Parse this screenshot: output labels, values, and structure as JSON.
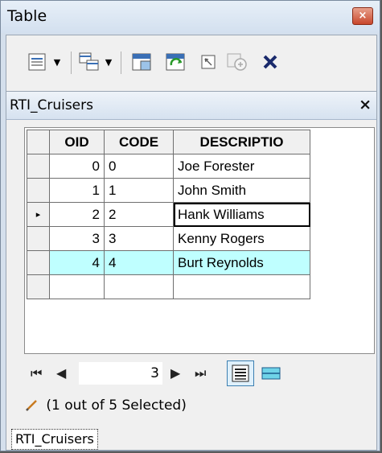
{
  "window": {
    "title": "Table",
    "close_glyph": "×"
  },
  "toolbar": {
    "buttons": [
      {
        "icon": "table-options-icon",
        "has_dropdown": true
      },
      {
        "icon": "related-tables-icon",
        "has_dropdown": true
      },
      {
        "icon": "select-by-attributes-icon"
      },
      {
        "icon": "switch-selection-icon"
      },
      {
        "icon": "clear-selection-icon"
      },
      {
        "icon": "zoom-to-selected-icon"
      },
      {
        "icon": "delete-selected-icon"
      }
    ]
  },
  "panel": {
    "title": "RTI_Cruisers",
    "close_glyph": "×"
  },
  "table": {
    "columns": [
      "OID",
      "CODE",
      "DESCRIPTIO"
    ],
    "rows": [
      {
        "oid": "0",
        "code": "0",
        "desc": "Joe Forester"
      },
      {
        "oid": "1",
        "code": "1",
        "desc": "John Smith"
      },
      {
        "oid": "2",
        "code": "2",
        "desc": "Hank Williams"
      },
      {
        "oid": "3",
        "code": "3",
        "desc": "Kenny Rogers"
      },
      {
        "oid": "4",
        "code": "4",
        "desc": "Burt Reynolds"
      }
    ],
    "current_row_marker": "▸",
    "highlight_color": "#bfffff"
  },
  "nav": {
    "first": "⏮",
    "prev": "◀",
    "current_record": "3",
    "next": "▶",
    "last": "⏭"
  },
  "status": {
    "text": "(1 out of 5 Selected)"
  },
  "tabs": [
    {
      "label": "RTI_Cruisers"
    }
  ]
}
